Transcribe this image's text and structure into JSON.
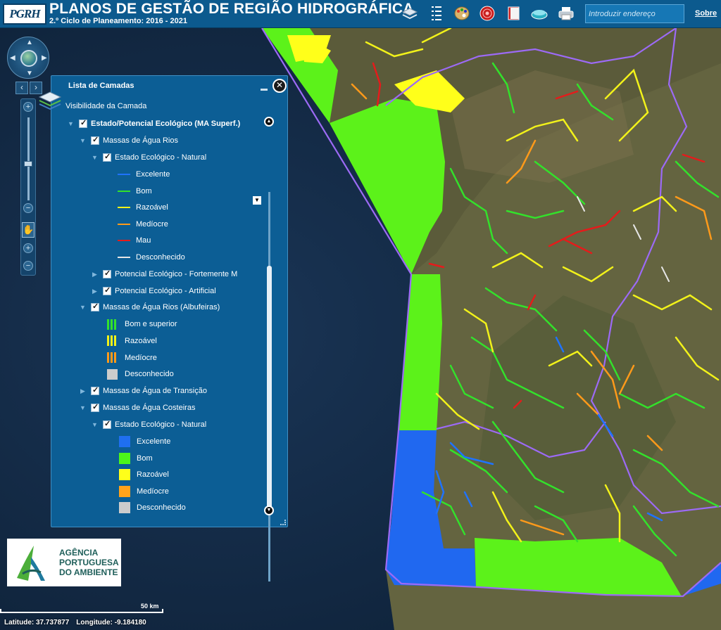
{
  "header": {
    "logo_text": "PGRH",
    "title": "PLANOS DE GESTÃO DE REGIÃO HIDROGRÁFICA",
    "subtitle": "2.º Ciclo de Planeamento: 2016 - 2021",
    "address_placeholder": "Introduzir endereço",
    "about_link": "Sobre",
    "toolbar_icons": [
      "layers-icon",
      "list-icon",
      "palette-icon",
      "target-icon",
      "book-icon",
      "basemap-icon",
      "print-icon"
    ]
  },
  "layer_panel": {
    "title": "Lista de Camadas",
    "visibility_label": "Visibilidade da Camada",
    "root_layer": "Estado/Potencial Ecológico (MA Superf.)",
    "rios": {
      "label": "Massas de Água Rios",
      "natural_label": "Estado Ecológico - Natural",
      "classes": [
        {
          "label": "Excelente",
          "color": "#1f73ff"
        },
        {
          "label": "Bom",
          "color": "#33e12b"
        },
        {
          "label": "Razoável",
          "color": "#f2f21a"
        },
        {
          "label": "Medíocre",
          "color": "#ff9a1a"
        },
        {
          "label": "Mau",
          "color": "#e51b1b"
        },
        {
          "label": "Desconhecido",
          "color": "#e6e6e6"
        }
      ],
      "fortemente_label": "Potencial Ecológico - Fortemente M",
      "artificial_label": "Potencial Ecológico - Artificial"
    },
    "albufeiras": {
      "label": "Massas de Água Rios (Albufeiras)",
      "classes": [
        {
          "label": "Bom e superior",
          "color": "#33e12b"
        },
        {
          "label": "Razoável",
          "color": "#f2f21a"
        },
        {
          "label": "Medíocre",
          "color": "#ff9a1a"
        },
        {
          "label": "Desconhecido",
          "color": "#cccccc"
        }
      ]
    },
    "transicao_label": "Massas de Água de Transição",
    "costeiras": {
      "label": "Massas de Água Costeiras",
      "natural_label": "Estado Ecológico - Natural",
      "classes": [
        {
          "label": "Excelente",
          "color": "#1f6ff0"
        },
        {
          "label": "Bom",
          "color": "#4cf51a"
        },
        {
          "label": "Razoável",
          "color": "#ffff1a"
        },
        {
          "label": "Medíocre",
          "color": "#ffa31a"
        },
        {
          "label": "Desconhecido",
          "color": "#cccccc"
        }
      ]
    }
  },
  "agency_logo": {
    "line1": "AGÊNCIA",
    "line2": "PORTUGUESA",
    "line3": "DO AMBIENTE"
  },
  "scale": {
    "label": "50 km"
  },
  "coordinates": {
    "latitude": "Latitude: 37.737877",
    "longitude": "Longitude: -9.184180"
  }
}
